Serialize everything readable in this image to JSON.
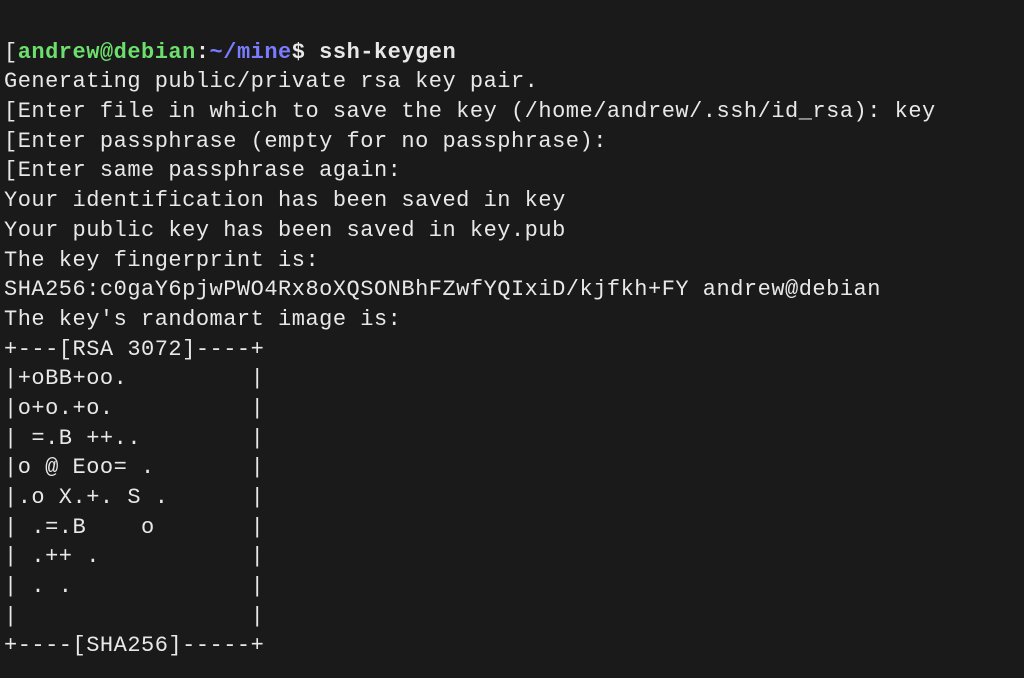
{
  "prompt": {
    "open_bracket": "[",
    "user": "andrew",
    "at": "@",
    "host": "debian",
    "colon": ":",
    "path": "~/mine",
    "dollar": "$ "
  },
  "command": "ssh-keygen",
  "output": {
    "line1": "Generating public/private rsa key pair.",
    "line2": "[Enter file in which to save the key (/home/andrew/.ssh/id_rsa): key",
    "line3": "[Enter passphrase (empty for no passphrase):",
    "line4": "[Enter same passphrase again:",
    "line5": "Your identification has been saved in key",
    "line6": "Your public key has been saved in key.pub",
    "line7": "The key fingerprint is:",
    "line8": "SHA256:c0gaY6pjwPWO4Rx8oXQSONBhFZwfYQIxiD/kjfkh+FY andrew@debian",
    "line9": "The key's randomart image is:",
    "art1": "+---[RSA 3072]----+",
    "art2": "|+oBB+oo.         |",
    "art3": "|o+o.+o.          |",
    "art4": "| =.B ++..        |",
    "art5": "|o @ Eoo= .       |",
    "art6": "|.o X.+. S .      |",
    "art7": "| .=.B    o       |",
    "art8": "| .++ .           |",
    "art9": "| . .             |",
    "art10": "|                 |",
    "art11": "+----[SHA256]-----+"
  }
}
